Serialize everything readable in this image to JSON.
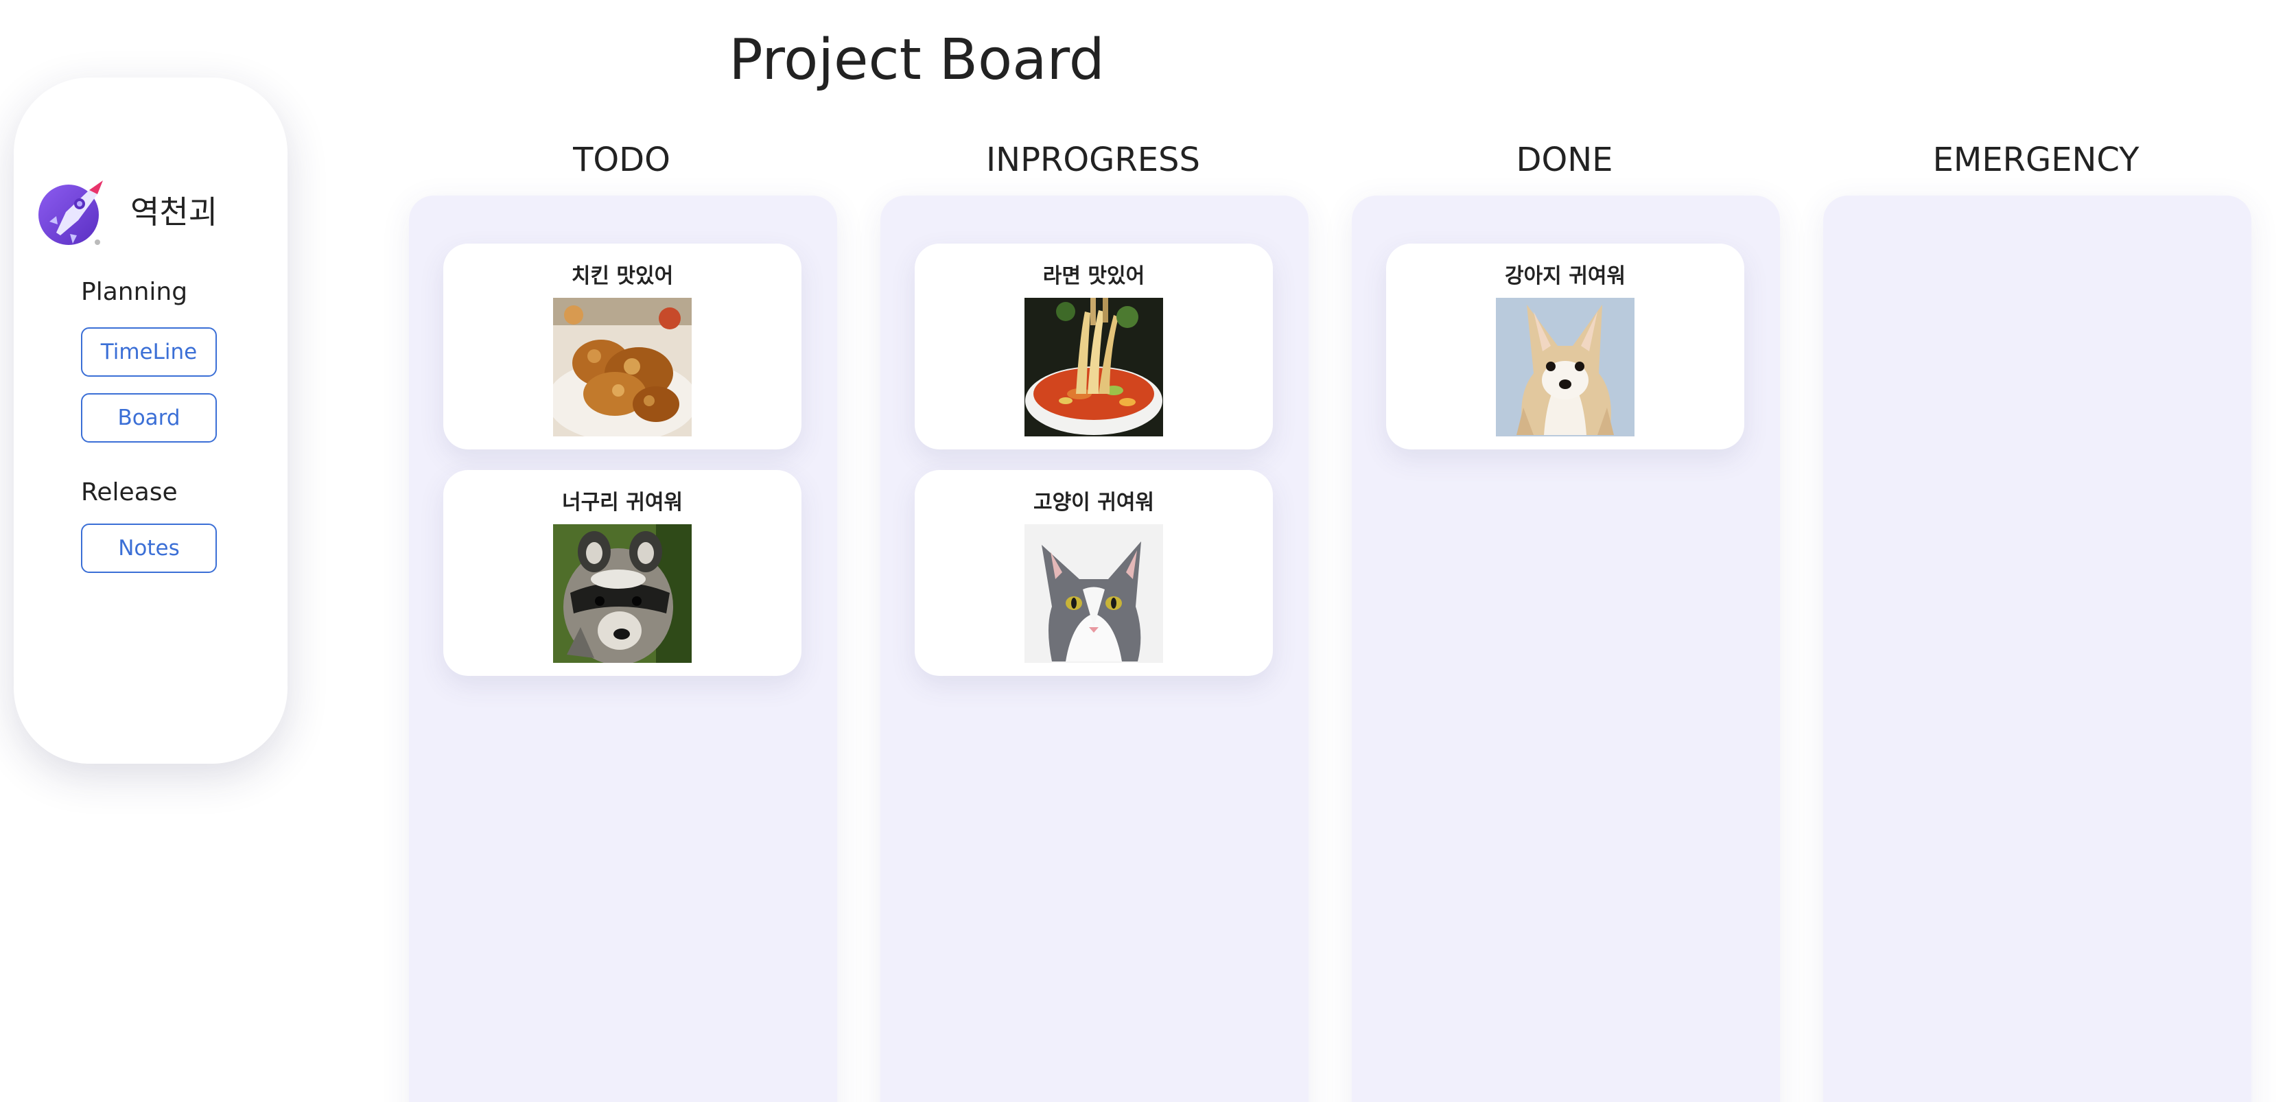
{
  "sidebar": {
    "brand": "역천괴",
    "logo_icon": "rocket-icon",
    "sections": [
      {
        "label": "Planning",
        "items": [
          "TimeLine",
          "Board"
        ]
      },
      {
        "label": "Release",
        "items": [
          "Notes"
        ]
      }
    ]
  },
  "page": {
    "title": "Project Board"
  },
  "colors": {
    "accent": "#3b6fd6",
    "column_bg": "#f1f0fc",
    "card_bg": "#ffffff"
  },
  "columns": [
    {
      "title": "TODO",
      "cards": [
        {
          "title": "치킨 맛있어",
          "image": "fried-chicken-photo"
        },
        {
          "title": "너구리 귀여워",
          "image": "raccoon-photo"
        }
      ]
    },
    {
      "title": "INPROGRESS",
      "cards": [
        {
          "title": "라면 맛있어",
          "image": "ramen-photo"
        },
        {
          "title": "고양이 귀여워",
          "image": "cat-photo"
        }
      ]
    },
    {
      "title": "DONE",
      "cards": [
        {
          "title": "강아지 귀여워",
          "image": "dog-photo"
        }
      ]
    },
    {
      "title": "EMERGENCY",
      "cards": []
    }
  ]
}
